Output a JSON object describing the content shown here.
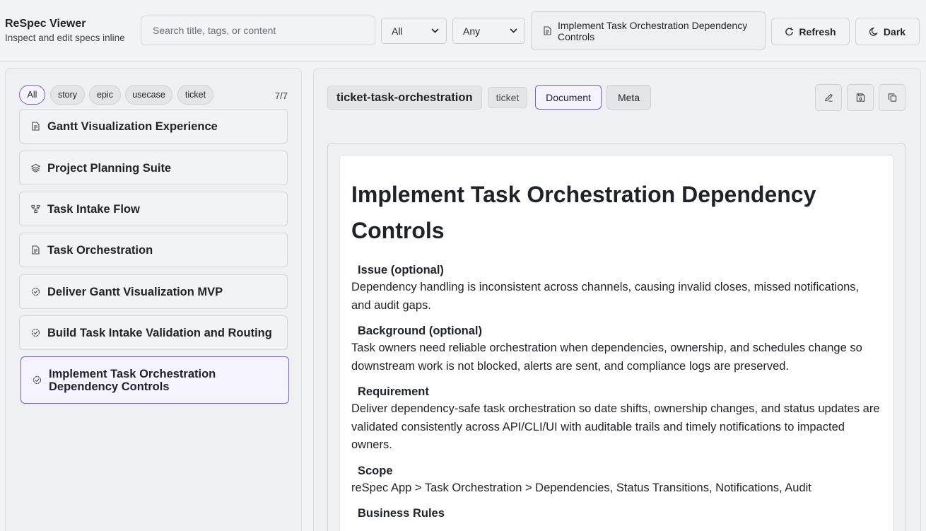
{
  "app": {
    "title": "ReSpec Viewer",
    "subtitle": "Inspect and edit specs inline"
  },
  "header": {
    "search_placeholder": "Search title, tags, or content",
    "type_filter": "All",
    "status_filter": "Any",
    "current_spec": "Implement Task Orchestration Dependency Controls",
    "refresh_label": "Refresh",
    "theme_label": "Dark"
  },
  "sidebar": {
    "chips": [
      "All",
      "story",
      "epic",
      "usecase",
      "ticket"
    ],
    "active_chip": "All",
    "count": "7/7",
    "items": [
      {
        "label": "Gantt Visualization Experience",
        "icon": "document-icon"
      },
      {
        "label": "Project Planning Suite",
        "icon": "layers-icon"
      },
      {
        "label": "Task Intake Flow",
        "icon": "flow-icon"
      },
      {
        "label": "Task Orchestration",
        "icon": "document-icon"
      },
      {
        "label": "Deliver Gantt Visualization MVP",
        "icon": "badge-check-icon"
      },
      {
        "label": "Build Task Intake Validation and Routing",
        "icon": "badge-check-icon"
      },
      {
        "label": "Implement Task Orchestration Dependency Controls",
        "icon": "badge-check-icon",
        "selected": true
      }
    ]
  },
  "main": {
    "spec_id": "ticket-task-orchestration",
    "type": "ticket",
    "tabs": [
      "Document",
      "Meta"
    ],
    "active_tab": "Document",
    "actions": [
      "edit-icon",
      "save-icon",
      "copy-icon"
    ],
    "doc": {
      "title": "Implement Task Orchestration Dependency Controls",
      "sections": [
        {
          "heading": "Issue (optional)",
          "body": "Dependency handling is inconsistent across channels, causing invalid closes, missed notifications, and audit gaps."
        },
        {
          "heading": "Background (optional)",
          "body": "Task owners need reliable orchestration when dependencies, ownership, and schedules change so downstream work is not blocked, alerts are sent, and compliance logs are preserved."
        },
        {
          "heading": "Requirement",
          "body": "Deliver dependency-safe task orchestration so date shifts, ownership changes, and status updates are validated consistently across API/CLI/UI with auditable trails and timely notifications to impacted owners."
        },
        {
          "heading": "Scope",
          "body": "reSpec App > Task Orchestration > Dependencies, Status Transitions, Notifications, Audit"
        },
        {
          "heading": "Business Rules",
          "body": ""
        }
      ]
    }
  },
  "colors": {
    "accent": "#7c5cdb",
    "background": "#f2f3f5",
    "panel": "#eef0f2"
  }
}
